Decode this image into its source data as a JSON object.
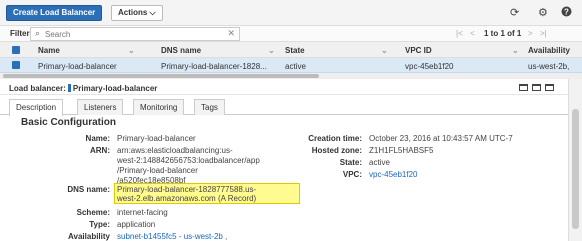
{
  "toolbar": {
    "create_label": "Create Load Balancer",
    "actions_label": "Actions ⌵",
    "icons": [
      "refresh-icon",
      "gear-icon",
      "help-icon"
    ]
  },
  "filter": {
    "label": "Filter:",
    "placeholder": "Search",
    "pagination": {
      "first": "|<",
      "prev": "<",
      "range": "1 to 1 of 1",
      "next": ">",
      "last": ">|"
    }
  },
  "table": {
    "columns": [
      "Name",
      "DNS name",
      "State",
      "VPC ID",
      "Availability"
    ],
    "rows": [
      {
        "name": "Primary-load-balancer",
        "dns": "Primary-load-balancer-1828...",
        "state": "active",
        "vpc": "vpc-45eb1f20",
        "az": "us-west-2b,"
      }
    ]
  },
  "detail": {
    "header_label": "Load balancer:",
    "header_value": "Primary-load-balancer",
    "tabs": [
      "Description",
      "Listeners",
      "Monitoring",
      "Tags"
    ],
    "section_title": "Basic Configuration",
    "left": {
      "name_label": "Name:",
      "name_value": "Primary-load-balancer",
      "arn_label": "ARN:",
      "arn_lines": [
        "arn:aws:elasticloadbalancing:us-",
        "west-2:148842656753:loadbalancer/app",
        "/Primary-load-balancer",
        "/a520fec18e8508bf"
      ],
      "dns_label": "DNS name:",
      "dns_line1": "Primary-load-balancer-1828777588.us-",
      "dns_line2": "west-2.elb.amazonaws.com",
      "dns_suffix": "(A Record)",
      "scheme_label": "Scheme:",
      "scheme_value": "internet-facing",
      "type_label": "Type:",
      "type_value": "application",
      "avail_label": "Availability",
      "avail_value": "subnet-b1455fc5 - us-west-2b ,"
    },
    "right": {
      "created_label": "Creation time:",
      "created_value": "October 23, 2016 at 10:43:57 AM UTC-7",
      "zone_label": "Hosted zone:",
      "zone_value": "Z1H1FL5HABSF5",
      "state_label": "State:",
      "state_value": "active",
      "vpc_label": "VPC:",
      "vpc_value": "vpc-45eb1f20"
    }
  },
  "colors": {
    "accent": "#2d6fb7",
    "selected_row": "#dbe9f7",
    "highlight": "#fffb8f",
    "link": "#1a66c2"
  }
}
